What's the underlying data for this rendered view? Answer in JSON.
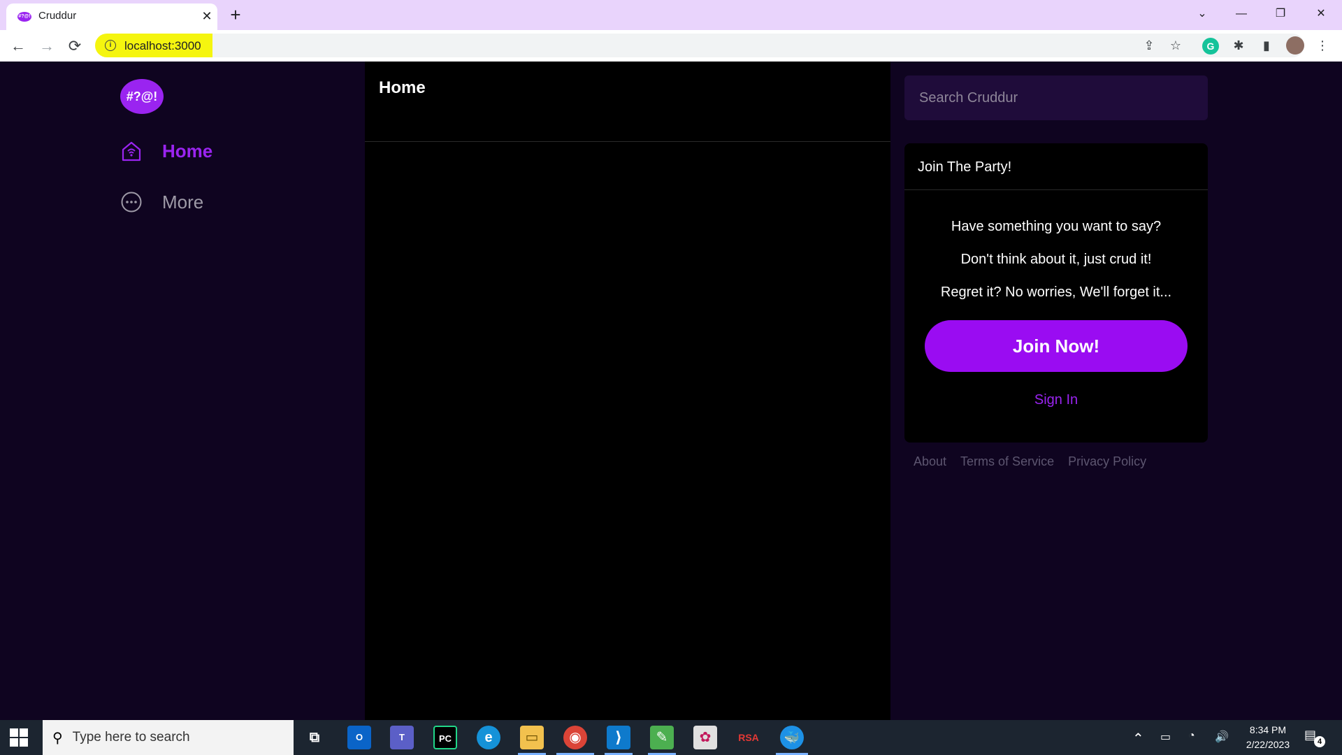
{
  "browser": {
    "tab_title": "Cruddur",
    "tab_favicon": "#?@!",
    "close_glyph": "✕",
    "newtab_glyph": "+",
    "url": "localhost:3000",
    "window_controls": {
      "tabsearch": "⌄",
      "minimize": "—",
      "restore": "❐",
      "close": "✕"
    },
    "nav": {
      "back": "←",
      "forward": "→",
      "reload": "⟳"
    },
    "toolbar_icons": {
      "share": "⇪",
      "star": "☆",
      "grammarly": "G",
      "extensions": "✱",
      "sidepanel": "▮",
      "menu": "⋮"
    }
  },
  "sidebar": {
    "logo_text": "#?@!",
    "items": [
      {
        "label": "Home",
        "icon": "home-icon",
        "active": true
      },
      {
        "label": "More",
        "icon": "more-dots-icon",
        "active": false
      }
    ]
  },
  "main": {
    "title": "Home"
  },
  "right": {
    "search": {
      "placeholder": "Search Cruddur"
    },
    "join_card": {
      "title": "Join The Party!",
      "lines": [
        "Have something you want to say?",
        "Don't think about it, just crud it!",
        "Regret it? No worries, We'll forget it..."
      ],
      "join_button": "Join Now!",
      "signin_link": "Sign In"
    },
    "footer_links": [
      "About",
      "Terms of Service",
      "Privacy Policy"
    ]
  },
  "taskbar": {
    "search_placeholder": "Type here to search",
    "search_glyph": "⚲",
    "apps": [
      {
        "name": "task-view",
        "glyph": "⧉"
      },
      {
        "name": "outlook",
        "glyph": "O"
      },
      {
        "name": "teams",
        "glyph": "T"
      },
      {
        "name": "pycharm",
        "glyph": "PC"
      },
      {
        "name": "edge",
        "glyph": "e"
      },
      {
        "name": "file-explorer",
        "glyph": "▭"
      },
      {
        "name": "chrome",
        "glyph": "◉"
      },
      {
        "name": "vscode",
        "glyph": "⟩"
      },
      {
        "name": "notepad",
        "glyph": "✎"
      },
      {
        "name": "paint",
        "glyph": "✿"
      },
      {
        "name": "rsa",
        "glyph": "RSA"
      },
      {
        "name": "docker",
        "glyph": "🐳"
      }
    ],
    "tray_glyphs": {
      "chevron": "⌃",
      "battery": "▭",
      "network": "◔",
      "volume": "🔊"
    },
    "time": "8:34 PM",
    "date": "2/22/2023",
    "notifications_glyph": "▤",
    "notifications_count": "4"
  },
  "colors": {
    "accent": "#9a24f0",
    "join_button": "#9a0cf2",
    "app_bg": "#0f0420",
    "main_bg": "#000000",
    "search_bg": "#1f0c3a"
  }
}
